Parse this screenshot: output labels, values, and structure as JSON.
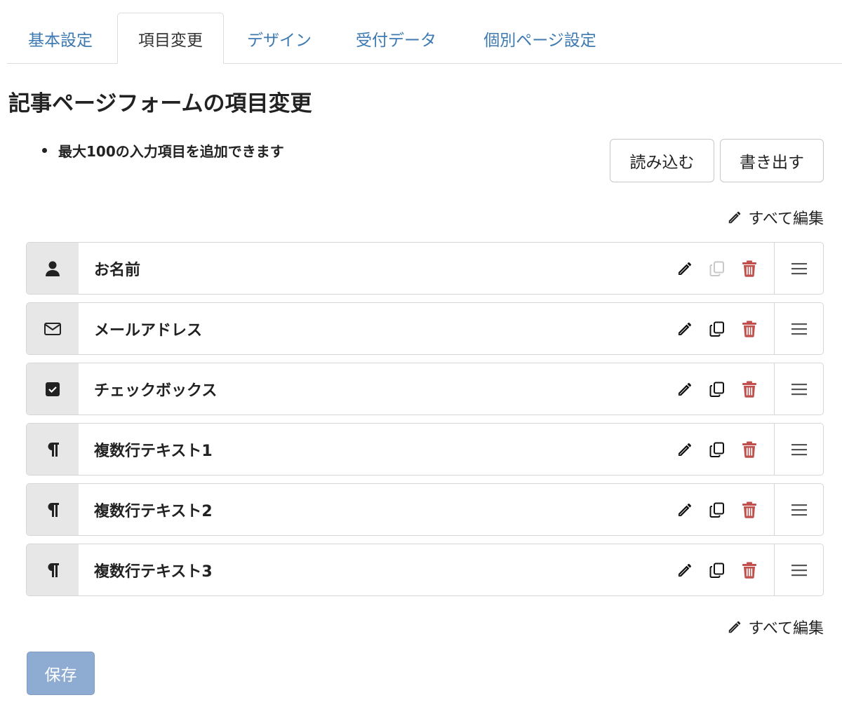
{
  "tabs": [
    {
      "label": "基本設定",
      "active": false
    },
    {
      "label": "項目変更",
      "active": true
    },
    {
      "label": "デザイン",
      "active": false
    },
    {
      "label": "受付データ",
      "active": false
    },
    {
      "label": "個別ページ設定",
      "active": false
    }
  ],
  "page_title": "記事ページフォームの項目変更",
  "note": "最大100の入力項目を追加できます",
  "buttons": {
    "import_label": "読み込む",
    "export_label": "書き出す",
    "save_label": "保存"
  },
  "edit_all_label": "すべて編集",
  "colors": {
    "tab_link": "#3d7ab2",
    "delete_icon": "#c0504d",
    "save_button": "#8eacd1",
    "type_cell": "#e7e7e7"
  },
  "fields": [
    {
      "label": "お名前",
      "type_icon": "user-icon",
      "copy_disabled": true
    },
    {
      "label": "メールアドレス",
      "type_icon": "envelope-icon",
      "copy_disabled": false
    },
    {
      "label": "チェックボックス",
      "type_icon": "checkbox-icon",
      "copy_disabled": false
    },
    {
      "label": "複数行テキスト1",
      "type_icon": "paragraph-icon",
      "copy_disabled": false
    },
    {
      "label": "複数行テキスト2",
      "type_icon": "paragraph-icon",
      "copy_disabled": false
    },
    {
      "label": "複数行テキスト3",
      "type_icon": "paragraph-icon",
      "copy_disabled": false
    }
  ]
}
